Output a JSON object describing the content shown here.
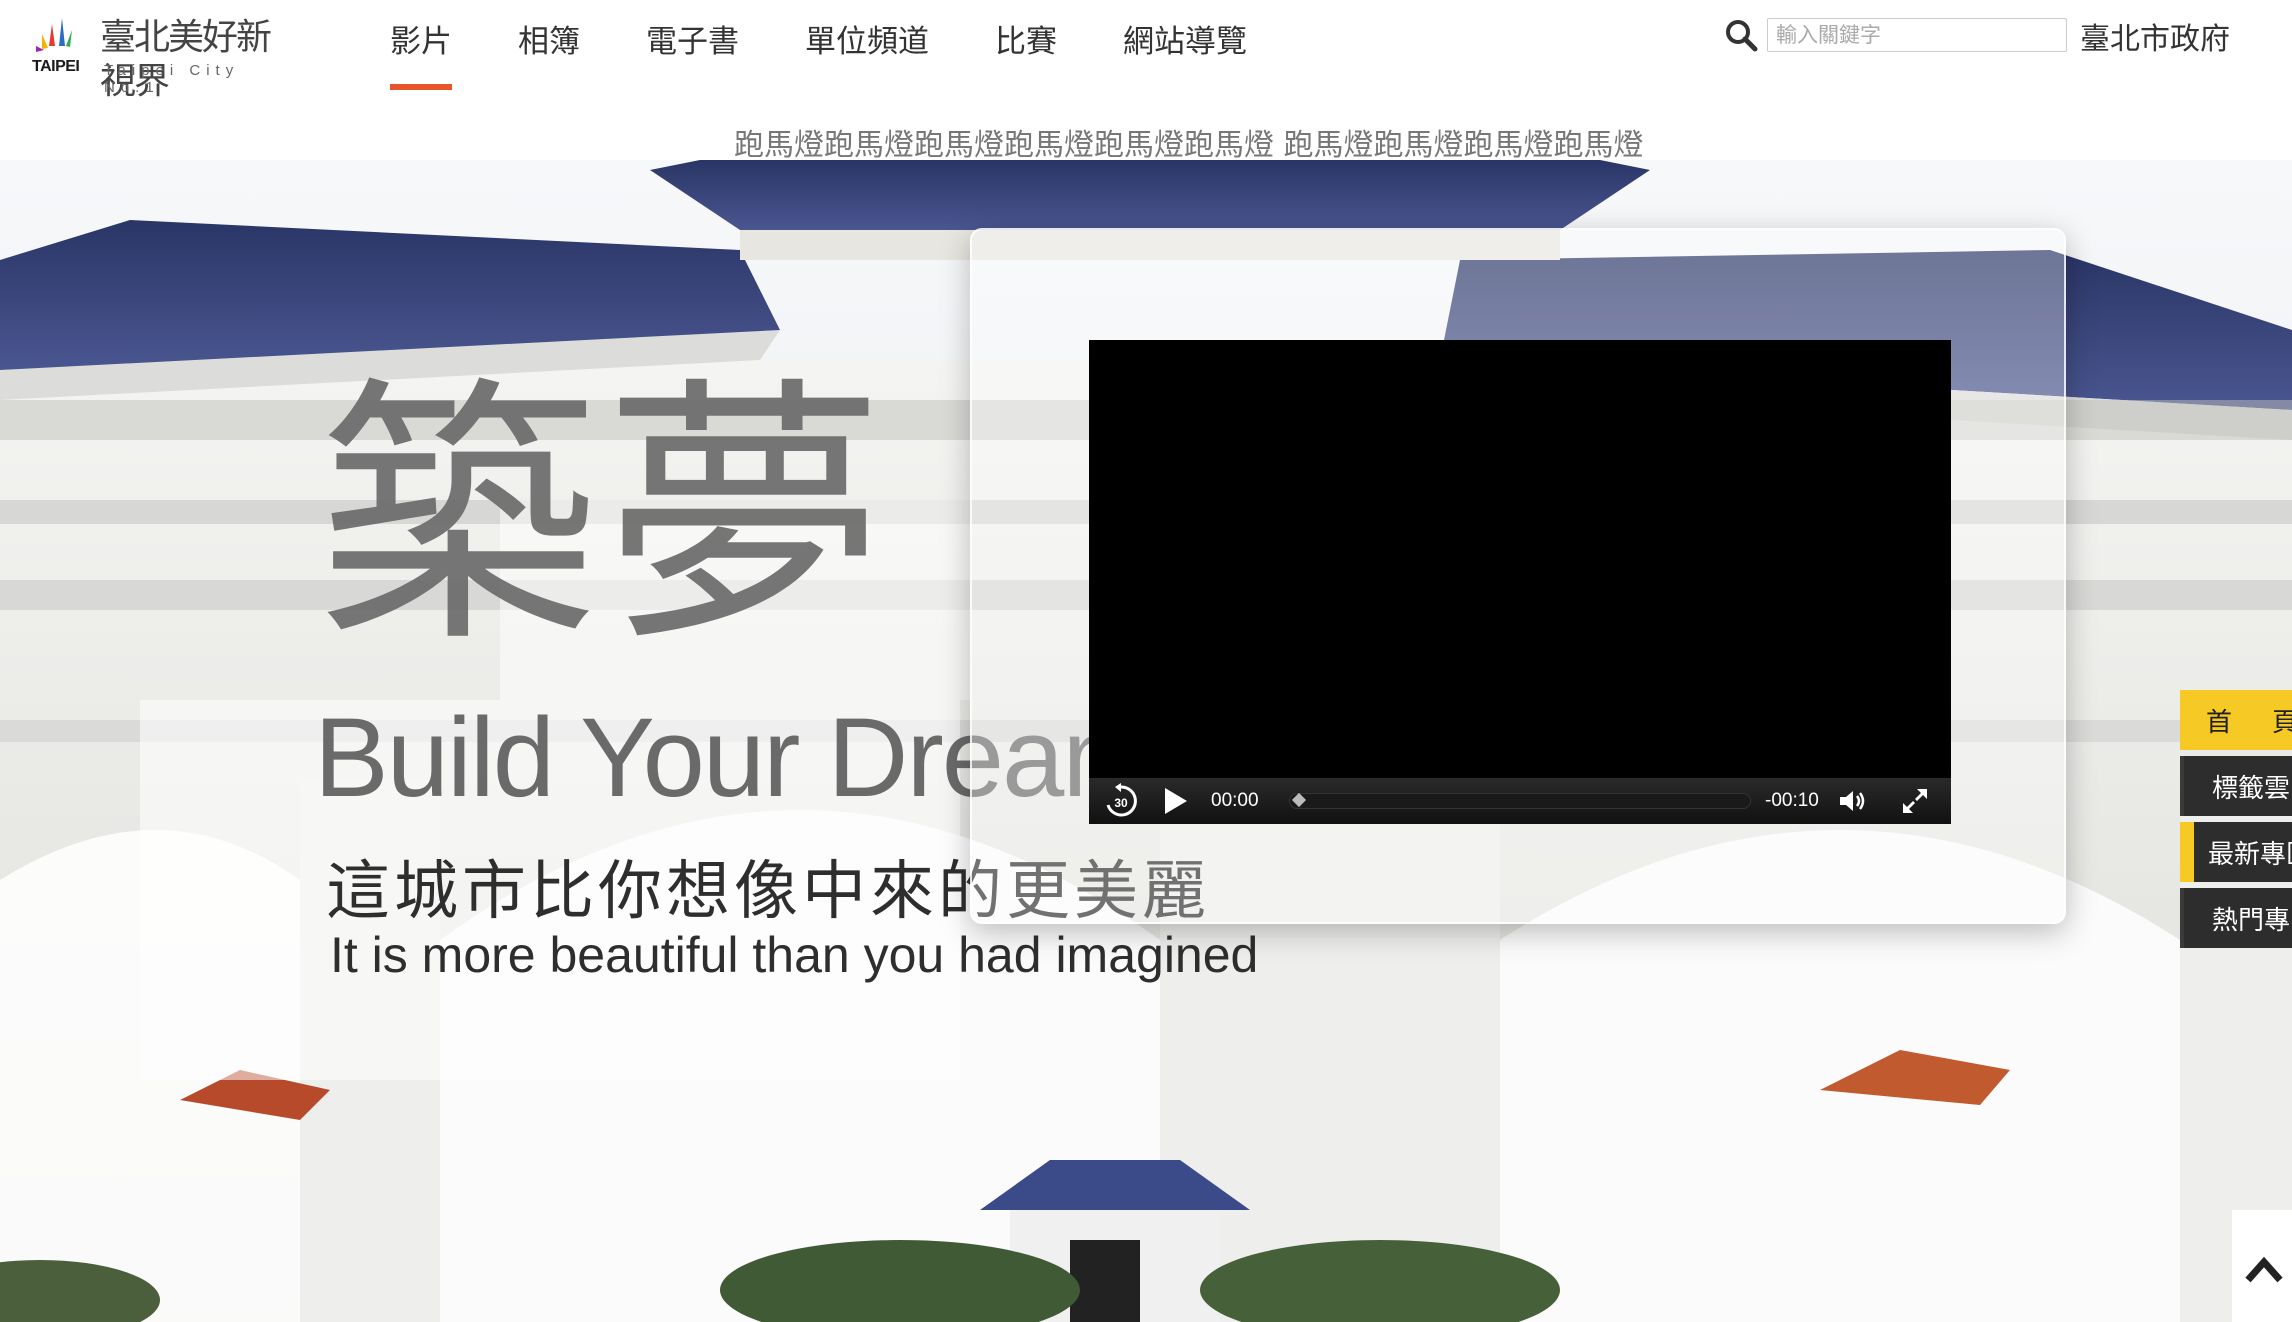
{
  "logo": {
    "title": "臺北美好新視界",
    "subtitle": "Taipei City No.1",
    "wordmark": "TAIPEI"
  },
  "nav": {
    "items": [
      {
        "label": "影片",
        "active": true
      },
      {
        "label": "相簿",
        "active": false
      },
      {
        "label": "電子書",
        "active": false
      },
      {
        "label": "單位頻道",
        "active": false
      },
      {
        "label": "比賽",
        "active": false
      },
      {
        "label": "網站導覽",
        "active": false
      }
    ]
  },
  "search": {
    "placeholder": "輸入關鍵字",
    "value": "",
    "icon": "search-icon"
  },
  "header_link": "臺北市政府",
  "marquee": "跑馬燈跑馬燈跑馬燈跑馬燈跑馬燈跑馬燈 跑馬燈跑馬燈跑馬燈跑馬燈",
  "hero": {
    "title_cn": "築夢",
    "title_en": "Build Your Dreams",
    "subtitle_cn": "這城市比你想像中來的更美麗",
    "subtitle_en": "It is more beautiful than you had imagined"
  },
  "video": {
    "current_time": "00:00",
    "remaining_time": "-00:10",
    "skip_back_label": "30",
    "progress": 0,
    "icons": [
      "skip-back-30-icon",
      "play-icon",
      "volume-icon",
      "fullscreen-icon"
    ]
  },
  "side_tabs": [
    {
      "label": "首頁",
      "style": "yellow"
    },
    {
      "label": "標籤雲",
      "style": "dark"
    },
    {
      "label": "最新專區",
      "style": "dark-accent"
    },
    {
      "label": "熱門專區",
      "style": "dark"
    }
  ],
  "colors": {
    "accent": "#e8552b",
    "tab_yellow": "#f7c925",
    "tab_dark": "#2d2d2d",
    "video_bg": "#000000"
  }
}
